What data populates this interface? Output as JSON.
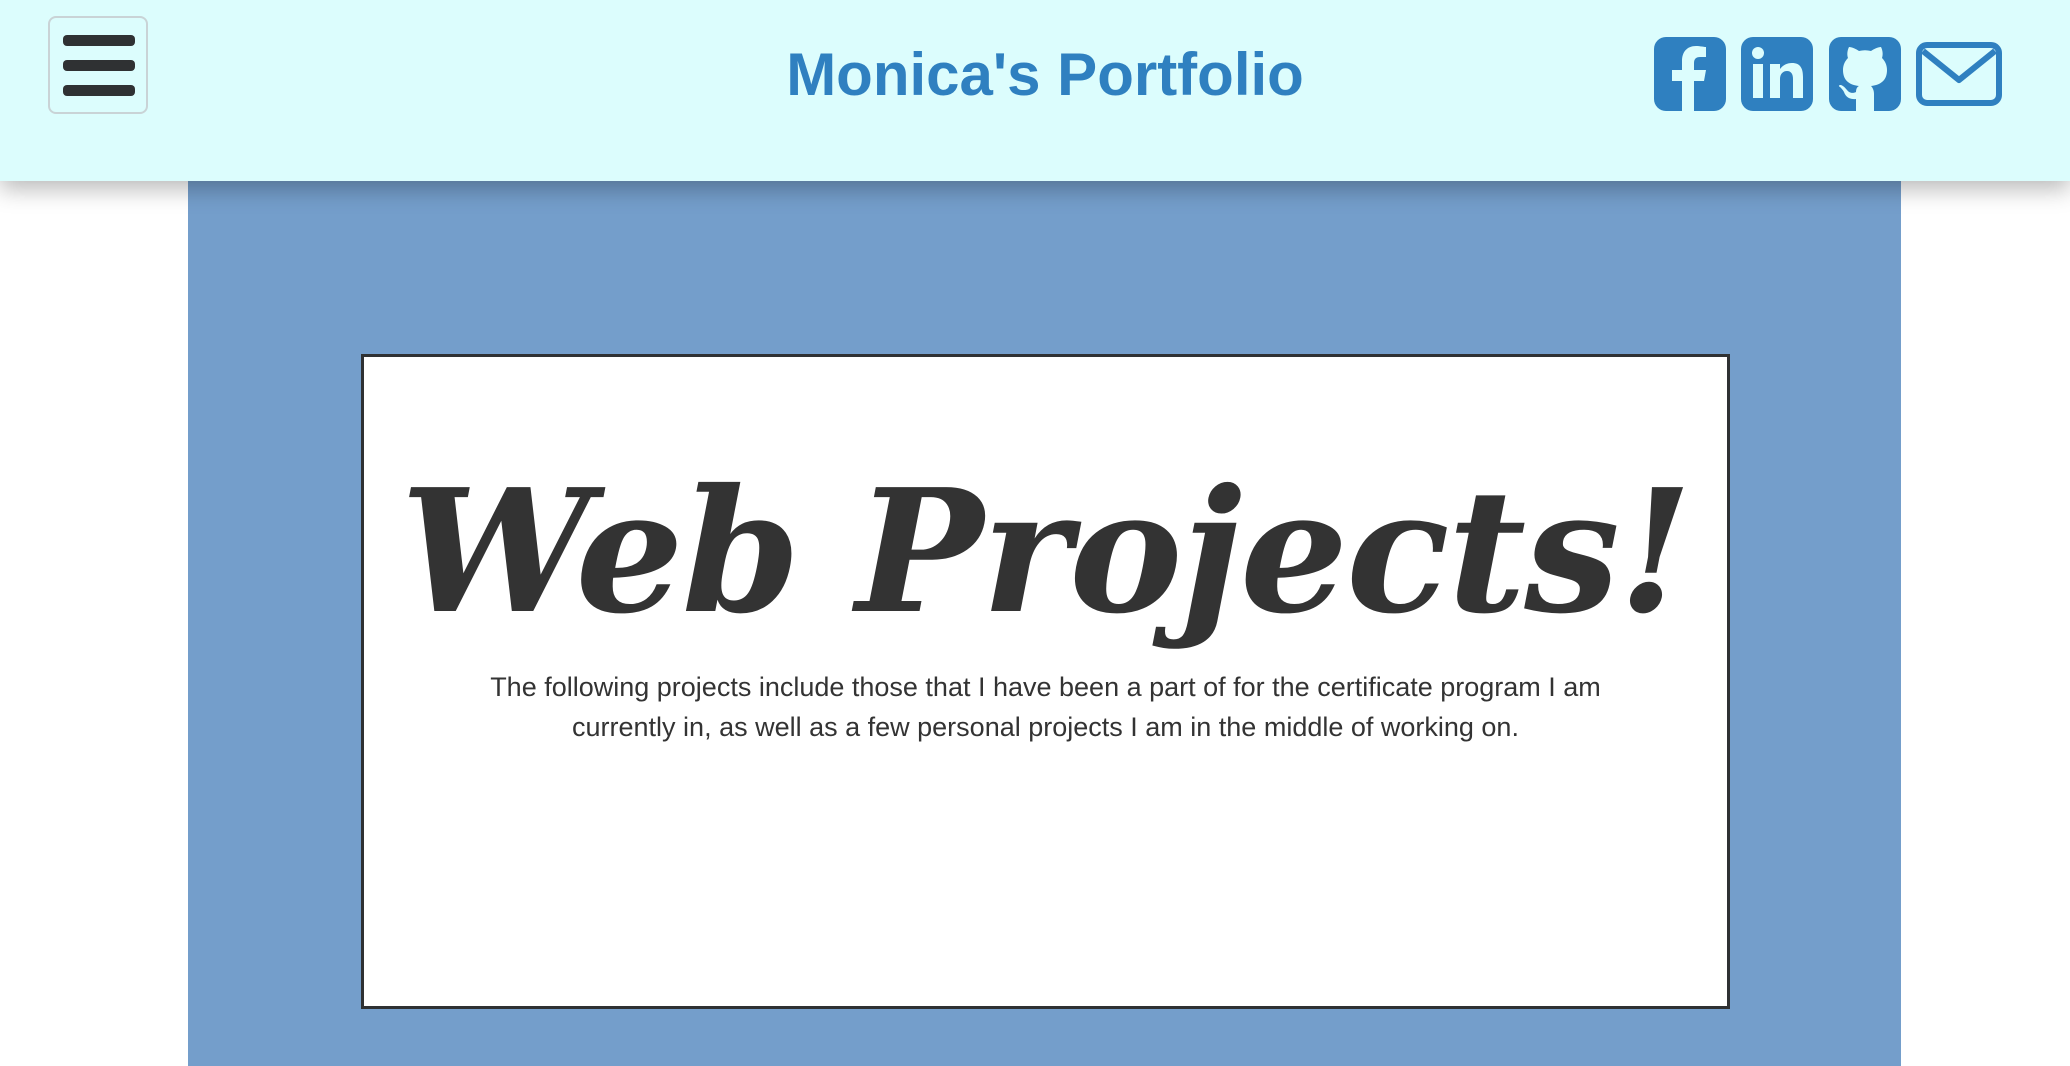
{
  "header": {
    "title": "Monica's Portfolio",
    "menu_icon": "hamburger-menu-icon",
    "social": [
      {
        "name": "facebook",
        "icon": "facebook-icon"
      },
      {
        "name": "linkedin",
        "icon": "linkedin-icon"
      },
      {
        "name": "github",
        "icon": "github-icon"
      },
      {
        "name": "email",
        "icon": "envelope-icon"
      }
    ]
  },
  "main": {
    "heading": "Web Projects!",
    "description": "The following projects include those that I have been a part of for the certificate program I am currently in, as well as a few personal projects I am in the middle of working on."
  },
  "colors": {
    "header_bg": "#dcfdfd",
    "accent": "#2f80c0",
    "band_bg": "#749ecb",
    "text": "#333333"
  }
}
